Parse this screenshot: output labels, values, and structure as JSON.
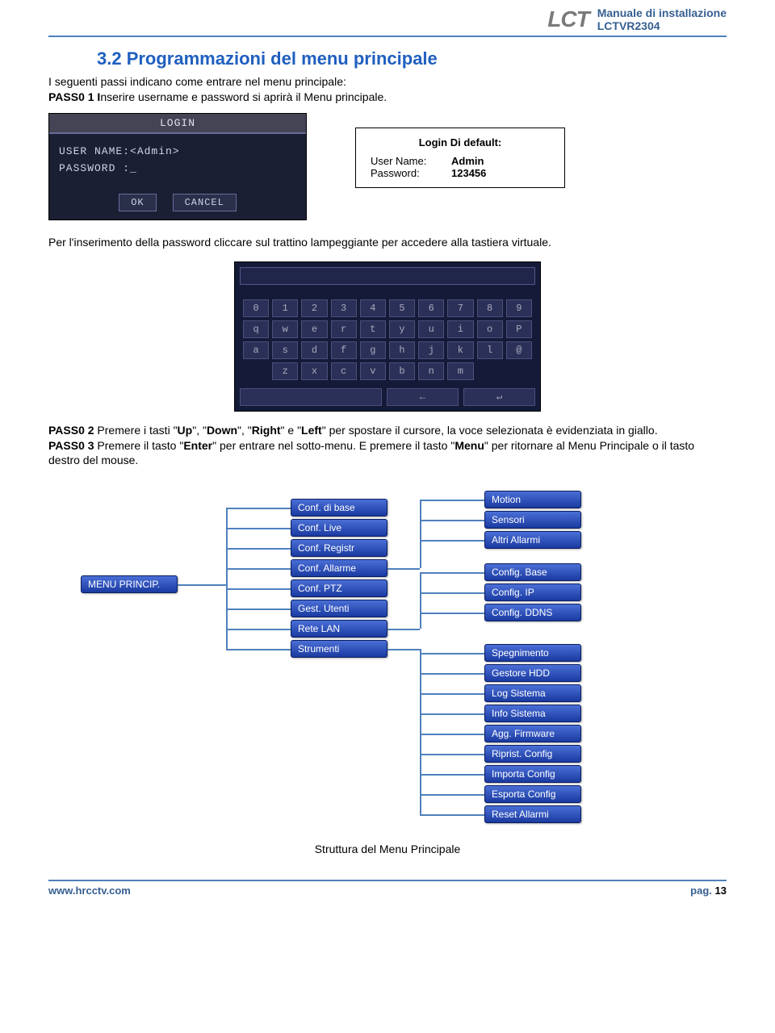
{
  "header": {
    "logo": "LCT",
    "line1": "Manuale di installazione",
    "line2": "LCTVR2304"
  },
  "section": {
    "number_title": "3.2  Programmazioni del menu principale",
    "intro": "I seguenti passi indicano come entrare nel menu principale:",
    "pass0_1_label": "PASS0 1 I",
    "pass0_1_rest": "nserire username e password si aprirà il Menu principale."
  },
  "login_box": {
    "title": "LOGIN",
    "line_user": "USER  NAME:<Admin>",
    "line_pass": "PASSWORD  :_",
    "btn_ok": "OK",
    "btn_cancel": "CANCEL"
  },
  "default_box": {
    "title": "Login Di default:",
    "k_user": "User Name:",
    "v_user": "Admin",
    "k_pass": "Password:",
    "v_pass": "123456"
  },
  "text_after_login": "Per l'inserimento della password cliccare sul trattino lampeggiante per accedere alla tastiera virtuale.",
  "keyboard": {
    "rows": [
      [
        "0",
        "1",
        "2",
        "3",
        "4",
        "5",
        "6",
        "7",
        "8",
        "9"
      ],
      [
        "q",
        "w",
        "e",
        "r",
        "t",
        "y",
        "u",
        "i",
        "o",
        "P"
      ],
      [
        "a",
        "s",
        "d",
        "f",
        "g",
        "h",
        "j",
        "k",
        "l",
        "@"
      ],
      [
        "",
        "z",
        "x",
        "c",
        "v",
        "b",
        "n",
        "m",
        "",
        ""
      ]
    ],
    "back_label": "←",
    "space_label": ""
  },
  "pass0_2": {
    "label": "PASS0 2",
    "text_a": " Premere i tasti \"",
    "up": "Up",
    "text_b": "\", \"",
    "down": "Down",
    "text_c": "\", \"",
    "right": "Right",
    "text_d": "\" e \"",
    "left": "Left",
    "text_e": "\" per spostare il cursore, la voce selezionata è evidenziata in giallo."
  },
  "pass0_3": {
    "label": "PASS0 3",
    "text_a": " Premere il tasto \"",
    "enter": "Enter",
    "text_b": "\" per entrare nel sotto-menu. E premere il tasto \"",
    "menu": "Menu",
    "text_c": "\" per ritornare al Menu Principale o il tasto destro del mouse."
  },
  "tree": {
    "root": "MENU PRINCIP.",
    "col2": [
      "Conf. di base",
      "Conf. Live",
      "Conf. Registr",
      "Conf. Allarme",
      "Conf. PTZ",
      "Gest. Utenti",
      "Rete LAN",
      "Strumenti"
    ],
    "group_a": [
      "Motion",
      "Sensori",
      "Altri Allarmi"
    ],
    "group_b": [
      "Config. Base",
      "Config. IP",
      "Config. DDNS"
    ],
    "group_c": [
      "Spegnimento",
      "Gestore HDD",
      "Log Sistema",
      "Info Sistema",
      "Agg. Firmware",
      "Riprist. Config",
      "Importa Config",
      "Esporta Config",
      "Reset Allarmi"
    ]
  },
  "caption": "Struttura del Menu Principale",
  "footer": {
    "url": "www.hrcctv.com",
    "page_label": "pag.",
    "page_num": "13"
  }
}
